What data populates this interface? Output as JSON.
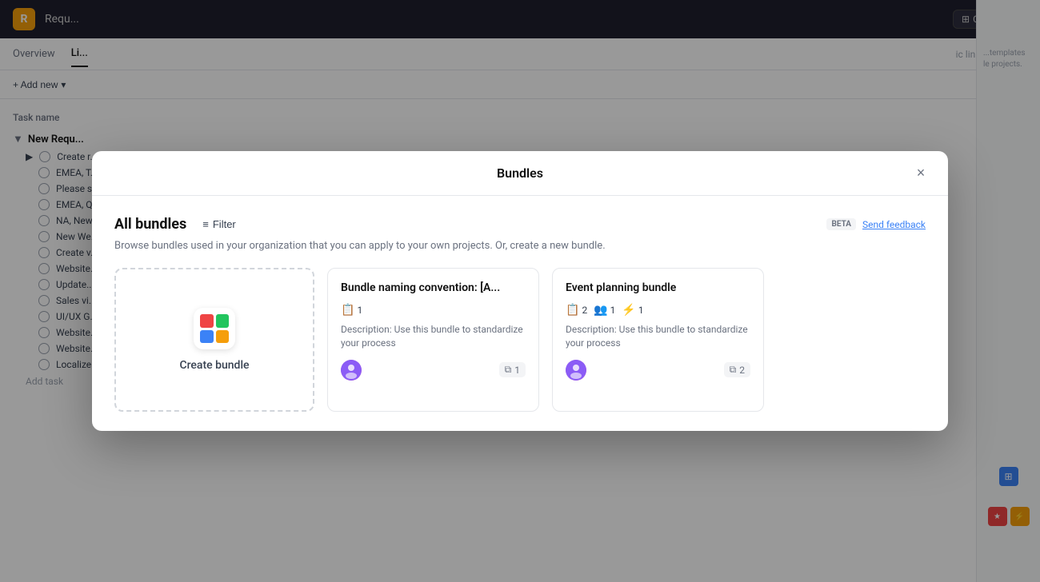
{
  "app": {
    "logo_letter": "R",
    "title": "Requ...",
    "customize_label": "Customize",
    "nav_tabs": [
      {
        "label": "Overview",
        "active": false
      },
      {
        "label": "Li...",
        "active": true
      },
      {
        "label": "...",
        "active": false
      }
    ],
    "add_new_label": "+ Add new",
    "task_header_label": "Task name",
    "task_group_label": "New Requ...",
    "tasks": [
      "Create r...",
      "EMEA, T...",
      "Please s...",
      "EMEA, Q...",
      "NA, New...",
      "New We...",
      "Create v...",
      "Website...",
      "Update...",
      "Sales vi...",
      "UI/UX G...",
      "Website...",
      "Website...",
      "Localize..."
    ],
    "add_task_label": "Add task"
  },
  "modal": {
    "title": "Bundles",
    "close_label": "×",
    "header": {
      "title": "All bundles",
      "filter_label": "Filter",
      "beta_label": "BETA",
      "feedback_label": "Send feedback"
    },
    "subtitle": "Browse bundles used in your organization that you can apply to your own projects. Or, create a new bundle.",
    "create_card": {
      "label": "Create bundle"
    },
    "bundles": [
      {
        "id": "bundle-1",
        "title": "Bundle naming convention: [A...",
        "tags": [
          {
            "icon": "📋",
            "count": "1"
          }
        ],
        "description": "Description: Use this bundle to standardize your process",
        "copy_count": "1"
      },
      {
        "id": "bundle-2",
        "title": "Event planning bundle",
        "tags": [
          {
            "icon": "📋",
            "count": "2"
          },
          {
            "icon": "👥",
            "count": "1"
          },
          {
            "icon": "⚡",
            "count": "1"
          }
        ],
        "description": "Description: Use this bundle to standardize your process",
        "copy_count": "2"
      }
    ]
  },
  "icons": {
    "filter": "≡",
    "close": "×",
    "copy": "⧉",
    "chevron_down": "▾",
    "triangle_right": "▶"
  }
}
